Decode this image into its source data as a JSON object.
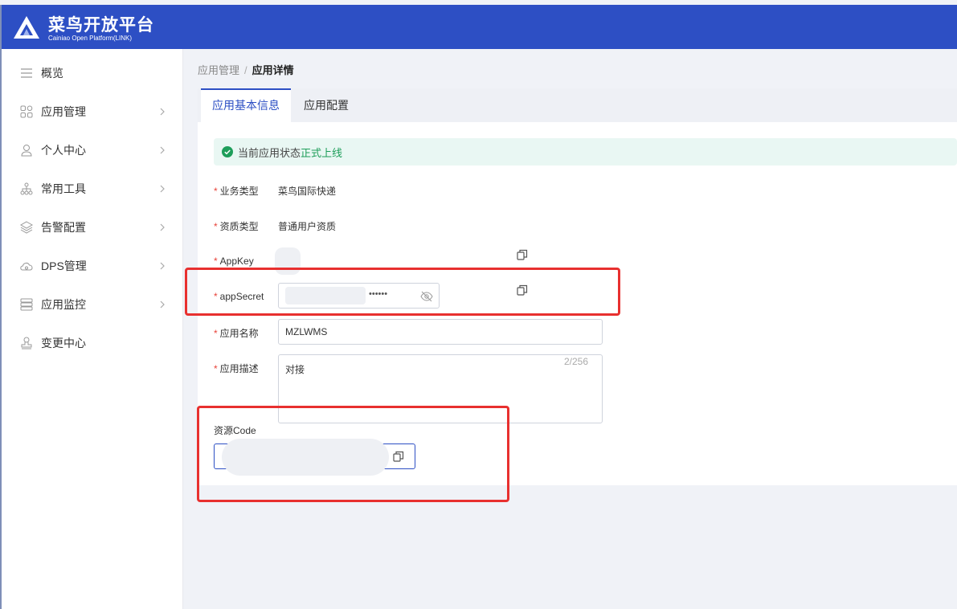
{
  "header": {
    "title": "菜鸟开放平台",
    "subtitle": "Cainiao Open Platform(LINK)"
  },
  "sidebar": {
    "items": [
      {
        "label": "概览",
        "icon": "menu-lines-icon",
        "chevron": false
      },
      {
        "label": "应用管理",
        "icon": "grid-icon",
        "chevron": true
      },
      {
        "label": "个人中心",
        "icon": "user-icon",
        "chevron": true
      },
      {
        "label": "常用工具",
        "icon": "org-tree-icon",
        "chevron": true
      },
      {
        "label": "告警配置",
        "icon": "layers-icon",
        "chevron": true
      },
      {
        "label": "DPS管理",
        "icon": "cloud-icon",
        "chevron": true
      },
      {
        "label": "应用监控",
        "icon": "server-icon",
        "chevron": true
      },
      {
        "label": "变更中心",
        "icon": "stamp-icon",
        "chevron": false
      }
    ]
  },
  "breadcrumb": {
    "parent": "应用管理",
    "separator": "/",
    "current": "应用详情"
  },
  "tabs": [
    {
      "label": "应用基本信息",
      "active": true
    },
    {
      "label": "应用配置",
      "active": false
    }
  ],
  "status_alert": {
    "prefix": "当前应用状态",
    "status": "正式上线"
  },
  "form": {
    "business_type": {
      "label": "业务类型",
      "value": "菜鸟国际快递"
    },
    "qualification_type": {
      "label": "资质类型",
      "value": "普通用户资质"
    },
    "app_key": {
      "label": "AppKey",
      "value": ""
    },
    "app_secret": {
      "label": "appSecret",
      "masked": "••••••"
    },
    "app_name": {
      "label": "应用名称",
      "value": "MZLWMS"
    },
    "app_desc": {
      "label": "应用描述",
      "value": "对接",
      "counter": "2/256"
    },
    "resource_code": {
      "label": "资源Code",
      "value": ""
    }
  },
  "colors": {
    "brand": "#2d4fc4",
    "success": "#1e9e5a",
    "required": "#e8433a",
    "annotation": "#e8302f"
  }
}
